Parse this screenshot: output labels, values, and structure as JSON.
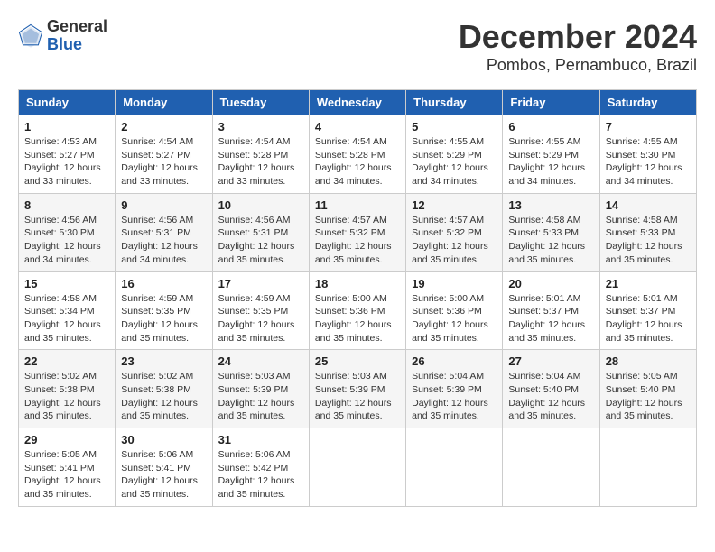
{
  "logo": {
    "general": "General",
    "blue": "Blue"
  },
  "title": "December 2024",
  "location": "Pombos, Pernambuco, Brazil",
  "days_header": [
    "Sunday",
    "Monday",
    "Tuesday",
    "Wednesday",
    "Thursday",
    "Friday",
    "Saturday"
  ],
  "weeks": [
    [
      {
        "day": "1",
        "sunrise": "4:53 AM",
        "sunset": "5:27 PM",
        "daylight": "12 hours and 33 minutes."
      },
      {
        "day": "2",
        "sunrise": "4:54 AM",
        "sunset": "5:27 PM",
        "daylight": "12 hours and 33 minutes."
      },
      {
        "day": "3",
        "sunrise": "4:54 AM",
        "sunset": "5:28 PM",
        "daylight": "12 hours and 33 minutes."
      },
      {
        "day": "4",
        "sunrise": "4:54 AM",
        "sunset": "5:28 PM",
        "daylight": "12 hours and 34 minutes."
      },
      {
        "day": "5",
        "sunrise": "4:55 AM",
        "sunset": "5:29 PM",
        "daylight": "12 hours and 34 minutes."
      },
      {
        "day": "6",
        "sunrise": "4:55 AM",
        "sunset": "5:29 PM",
        "daylight": "12 hours and 34 minutes."
      },
      {
        "day": "7",
        "sunrise": "4:55 AM",
        "sunset": "5:30 PM",
        "daylight": "12 hours and 34 minutes."
      }
    ],
    [
      {
        "day": "8",
        "sunrise": "4:56 AM",
        "sunset": "5:30 PM",
        "daylight": "12 hours and 34 minutes."
      },
      {
        "day": "9",
        "sunrise": "4:56 AM",
        "sunset": "5:31 PM",
        "daylight": "12 hours and 34 minutes."
      },
      {
        "day": "10",
        "sunrise": "4:56 AM",
        "sunset": "5:31 PM",
        "daylight": "12 hours and 35 minutes."
      },
      {
        "day": "11",
        "sunrise": "4:57 AM",
        "sunset": "5:32 PM",
        "daylight": "12 hours and 35 minutes."
      },
      {
        "day": "12",
        "sunrise": "4:57 AM",
        "sunset": "5:32 PM",
        "daylight": "12 hours and 35 minutes."
      },
      {
        "day": "13",
        "sunrise": "4:58 AM",
        "sunset": "5:33 PM",
        "daylight": "12 hours and 35 minutes."
      },
      {
        "day": "14",
        "sunrise": "4:58 AM",
        "sunset": "5:33 PM",
        "daylight": "12 hours and 35 minutes."
      }
    ],
    [
      {
        "day": "15",
        "sunrise": "4:58 AM",
        "sunset": "5:34 PM",
        "daylight": "12 hours and 35 minutes."
      },
      {
        "day": "16",
        "sunrise": "4:59 AM",
        "sunset": "5:35 PM",
        "daylight": "12 hours and 35 minutes."
      },
      {
        "day": "17",
        "sunrise": "4:59 AM",
        "sunset": "5:35 PM",
        "daylight": "12 hours and 35 minutes."
      },
      {
        "day": "18",
        "sunrise": "5:00 AM",
        "sunset": "5:36 PM",
        "daylight": "12 hours and 35 minutes."
      },
      {
        "day": "19",
        "sunrise": "5:00 AM",
        "sunset": "5:36 PM",
        "daylight": "12 hours and 35 minutes."
      },
      {
        "day": "20",
        "sunrise": "5:01 AM",
        "sunset": "5:37 PM",
        "daylight": "12 hours and 35 minutes."
      },
      {
        "day": "21",
        "sunrise": "5:01 AM",
        "sunset": "5:37 PM",
        "daylight": "12 hours and 35 minutes."
      }
    ],
    [
      {
        "day": "22",
        "sunrise": "5:02 AM",
        "sunset": "5:38 PM",
        "daylight": "12 hours and 35 minutes."
      },
      {
        "day": "23",
        "sunrise": "5:02 AM",
        "sunset": "5:38 PM",
        "daylight": "12 hours and 35 minutes."
      },
      {
        "day": "24",
        "sunrise": "5:03 AM",
        "sunset": "5:39 PM",
        "daylight": "12 hours and 35 minutes."
      },
      {
        "day": "25",
        "sunrise": "5:03 AM",
        "sunset": "5:39 PM",
        "daylight": "12 hours and 35 minutes."
      },
      {
        "day": "26",
        "sunrise": "5:04 AM",
        "sunset": "5:39 PM",
        "daylight": "12 hours and 35 minutes."
      },
      {
        "day": "27",
        "sunrise": "5:04 AM",
        "sunset": "5:40 PM",
        "daylight": "12 hours and 35 minutes."
      },
      {
        "day": "28",
        "sunrise": "5:05 AM",
        "sunset": "5:40 PM",
        "daylight": "12 hours and 35 minutes."
      }
    ],
    [
      {
        "day": "29",
        "sunrise": "5:05 AM",
        "sunset": "5:41 PM",
        "daylight": "12 hours and 35 minutes."
      },
      {
        "day": "30",
        "sunrise": "5:06 AM",
        "sunset": "5:41 PM",
        "daylight": "12 hours and 35 minutes."
      },
      {
        "day": "31",
        "sunrise": "5:06 AM",
        "sunset": "5:42 PM",
        "daylight": "12 hours and 35 minutes."
      },
      null,
      null,
      null,
      null
    ]
  ]
}
